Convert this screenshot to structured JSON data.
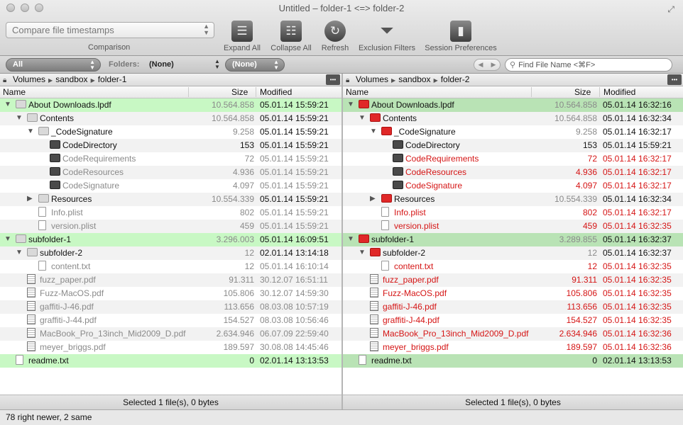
{
  "window": {
    "title": "Untitled – folder-1 <=> folder-2"
  },
  "toolbar": {
    "comparison_value": "Compare file timestamps",
    "comparison_label": "Comparison",
    "expand_all": "Expand All",
    "collapse_all": "Collapse All",
    "refresh": "Refresh",
    "exclusion_filters": "Exclusion Filters",
    "session_preferences": "Session Preferences"
  },
  "filterbar": {
    "view_value": "All",
    "folders_label": "Folders:",
    "folders_value": "(None)",
    "right_filter_value": "(None)",
    "search_placeholder": "Find File Name <⌘F>"
  },
  "columns": {
    "name": "Name",
    "size": "Size",
    "modified": "Modified"
  },
  "left": {
    "path": [
      "Volumes",
      "sandbox",
      "folder-1"
    ],
    "status": "Selected 1 file(s), 0 bytes",
    "rows": [
      {
        "depth": 0,
        "tri": "▼",
        "icon": "folder",
        "name": "About Downloads.lpdf",
        "size": "10.564.858",
        "sz_style": "gray",
        "modified": "05.01.14 15:59:21",
        "md_style": "dark",
        "hl": true
      },
      {
        "depth": 1,
        "tri": "▼",
        "icon": "folder",
        "name": "Contents",
        "size": "10.564.858",
        "sz_style": "gray",
        "modified": "05.01.14 15:59:21",
        "md_style": "dark"
      },
      {
        "depth": 2,
        "tri": "▼",
        "icon": "folder",
        "name": "_CodeSignature",
        "size": "9.258",
        "sz_style": "gray",
        "modified": "05.01.14 15:59:21",
        "md_style": "dark"
      },
      {
        "depth": 3,
        "tri": "",
        "icon": "bundle",
        "name": "CodeDirectory",
        "size": "153",
        "sz_style": "dark",
        "modified": "05.01.14 15:59:21",
        "md_style": "dark",
        "nm_style": "dark"
      },
      {
        "depth": 3,
        "tri": "",
        "icon": "bundle",
        "name": "CodeRequirements",
        "size": "72",
        "sz_style": "gray",
        "modified": "05.01.14 15:59:21",
        "md_style": "gray",
        "nm_style": "gray"
      },
      {
        "depth": 3,
        "tri": "",
        "icon": "bundle",
        "name": "CodeResources",
        "size": "4.936",
        "sz_style": "gray",
        "modified": "05.01.14 15:59:21",
        "md_style": "gray",
        "nm_style": "gray"
      },
      {
        "depth": 3,
        "tri": "",
        "icon": "bundle",
        "name": "CodeSignature",
        "size": "4.097",
        "sz_style": "gray",
        "modified": "05.01.14 15:59:21",
        "md_style": "gray",
        "nm_style": "gray"
      },
      {
        "depth": 2,
        "tri": "▶",
        "icon": "folder",
        "name": "Resources",
        "size": "10.554.339",
        "sz_style": "gray",
        "modified": "05.01.14 15:59:21",
        "md_style": "dark"
      },
      {
        "depth": 2,
        "tri": "",
        "icon": "file",
        "name": "Info.plist",
        "size": "802",
        "sz_style": "gray",
        "modified": "05.01.14 15:59:21",
        "md_style": "gray",
        "nm_style": "gray"
      },
      {
        "depth": 2,
        "tri": "",
        "icon": "file",
        "name": "version.plist",
        "size": "459",
        "sz_style": "gray",
        "modified": "05.01.14 15:59:21",
        "md_style": "gray",
        "nm_style": "gray"
      },
      {
        "depth": 0,
        "tri": "▼",
        "icon": "folder",
        "name": "subfolder-1",
        "size": "3.296.003",
        "sz_style": "gray",
        "modified": "05.01.14 16:09:51",
        "md_style": "dark",
        "hl": true
      },
      {
        "depth": 1,
        "tri": "▼",
        "icon": "folder",
        "name": "subfolder-2",
        "size": "12",
        "sz_style": "gray",
        "modified": "02.01.14 13:14:18",
        "md_style": "dark"
      },
      {
        "depth": 2,
        "tri": "",
        "icon": "file",
        "name": "content.txt",
        "size": "12",
        "sz_style": "gray",
        "modified": "05.01.14 16:10:14",
        "md_style": "gray",
        "nm_style": "gray"
      },
      {
        "depth": 1,
        "tri": "",
        "icon": "fileimg",
        "name": "fuzz_paper.pdf",
        "size": "91.311",
        "sz_style": "gray",
        "modified": "30.12.07 16:51:11",
        "md_style": "gray",
        "nm_style": "gray"
      },
      {
        "depth": 1,
        "tri": "",
        "icon": "fileimg",
        "name": "Fuzz-MacOS.pdf",
        "size": "105.806",
        "sz_style": "gray",
        "modified": "30.12.07 14:59:30",
        "md_style": "gray",
        "nm_style": "gray"
      },
      {
        "depth": 1,
        "tri": "",
        "icon": "fileimg",
        "name": "gaffiti-J-46.pdf",
        "size": "113.656",
        "sz_style": "gray",
        "modified": "08.03.08 10:57:19",
        "md_style": "gray",
        "nm_style": "gray"
      },
      {
        "depth": 1,
        "tri": "",
        "icon": "fileimg",
        "name": "graffiti-J-44.pdf",
        "size": "154.527",
        "sz_style": "gray",
        "modified": "08.03.08 10:56:46",
        "md_style": "gray",
        "nm_style": "gray"
      },
      {
        "depth": 1,
        "tri": "",
        "icon": "fileimg",
        "name": "MacBook_Pro_13inch_Mid2009_D.pdf",
        "size": "2.634.946",
        "sz_style": "gray",
        "modified": "06.07.09 22:59:40",
        "md_style": "gray",
        "nm_style": "gray"
      },
      {
        "depth": 1,
        "tri": "",
        "icon": "fileimg",
        "name": "meyer_briggs.pdf",
        "size": "189.597",
        "sz_style": "gray",
        "modified": "30.08.08 14:45:46",
        "md_style": "gray",
        "nm_style": "gray"
      },
      {
        "depth": 0,
        "tri": "",
        "icon": "file",
        "name": "readme.txt",
        "size": "0",
        "sz_style": "dark",
        "modified": "02.01.14 13:13:53",
        "md_style": "dark",
        "hl": true
      }
    ]
  },
  "right": {
    "path": [
      "Volumes",
      "sandbox",
      "folder-2"
    ],
    "status": "Selected 1 file(s), 0 bytes",
    "rows": [
      {
        "depth": 0,
        "tri": "▼",
        "icon": "folder",
        "name": "About Downloads.lpdf",
        "size": "10.564.858",
        "sz_style": "gray",
        "modified": "05.01.14 16:32:16",
        "md_style": "dark",
        "hl": true
      },
      {
        "depth": 1,
        "tri": "▼",
        "icon": "folder",
        "name": "Contents",
        "size": "10.564.858",
        "sz_style": "gray",
        "modified": "05.01.14 16:32:34",
        "md_style": "dark"
      },
      {
        "depth": 2,
        "tri": "▼",
        "icon": "folder",
        "name": "_CodeSignature",
        "size": "9.258",
        "sz_style": "gray",
        "modified": "05.01.14 16:32:17",
        "md_style": "dark"
      },
      {
        "depth": 3,
        "tri": "",
        "icon": "bundle",
        "name": "CodeDirectory",
        "size": "153",
        "sz_style": "dark",
        "modified": "05.01.14 15:59:21",
        "md_style": "dark",
        "nm_style": "dark"
      },
      {
        "depth": 3,
        "tri": "",
        "icon": "bundle",
        "name": "CodeRequirements",
        "size": "72",
        "sz_style": "red",
        "modified": "05.01.14 16:32:17",
        "md_style": "red",
        "nm_style": "red"
      },
      {
        "depth": 3,
        "tri": "",
        "icon": "bundle",
        "name": "CodeResources",
        "size": "4.936",
        "sz_style": "red",
        "modified": "05.01.14 16:32:17",
        "md_style": "red",
        "nm_style": "red"
      },
      {
        "depth": 3,
        "tri": "",
        "icon": "bundle",
        "name": "CodeSignature",
        "size": "4.097",
        "sz_style": "red",
        "modified": "05.01.14 16:32:17",
        "md_style": "red",
        "nm_style": "red"
      },
      {
        "depth": 2,
        "tri": "▶",
        "icon": "folder",
        "name": "Resources",
        "size": "10.554.339",
        "sz_style": "gray",
        "modified": "05.01.14 16:32:34",
        "md_style": "dark"
      },
      {
        "depth": 2,
        "tri": "",
        "icon": "file",
        "name": "Info.plist",
        "size": "802",
        "sz_style": "red",
        "modified": "05.01.14 16:32:17",
        "md_style": "red",
        "nm_style": "red"
      },
      {
        "depth": 2,
        "tri": "",
        "icon": "file",
        "name": "version.plist",
        "size": "459",
        "sz_style": "red",
        "modified": "05.01.14 16:32:35",
        "md_style": "red",
        "nm_style": "red"
      },
      {
        "depth": 0,
        "tri": "▼",
        "icon": "folder",
        "name": "subfolder-1",
        "size": "3.289.855",
        "sz_style": "gray",
        "modified": "05.01.14 16:32:37",
        "md_style": "dark",
        "hl": true
      },
      {
        "depth": 1,
        "tri": "▼",
        "icon": "folder",
        "name": "subfolder-2",
        "size": "12",
        "sz_style": "gray",
        "modified": "05.01.14 16:32:37",
        "md_style": "dark"
      },
      {
        "depth": 2,
        "tri": "",
        "icon": "file",
        "name": "content.txt",
        "size": "12",
        "sz_style": "red",
        "modified": "05.01.14 16:32:35",
        "md_style": "red",
        "nm_style": "red"
      },
      {
        "depth": 1,
        "tri": "",
        "icon": "fileimg",
        "name": "fuzz_paper.pdf",
        "size": "91.311",
        "sz_style": "red",
        "modified": "05.01.14 16:32:35",
        "md_style": "red",
        "nm_style": "red"
      },
      {
        "depth": 1,
        "tri": "",
        "icon": "fileimg",
        "name": "Fuzz-MacOS.pdf",
        "size": "105.806",
        "sz_style": "red",
        "modified": "05.01.14 16:32:35",
        "md_style": "red",
        "nm_style": "red"
      },
      {
        "depth": 1,
        "tri": "",
        "icon": "fileimg",
        "name": "gaffiti-J-46.pdf",
        "size": "113.656",
        "sz_style": "red",
        "modified": "05.01.14 16:32:35",
        "md_style": "red",
        "nm_style": "red"
      },
      {
        "depth": 1,
        "tri": "",
        "icon": "fileimg",
        "name": "graffiti-J-44.pdf",
        "size": "154.527",
        "sz_style": "red",
        "modified": "05.01.14 16:32:35",
        "md_style": "red",
        "nm_style": "red"
      },
      {
        "depth": 1,
        "tri": "",
        "icon": "fileimg",
        "name": "MacBook_Pro_13inch_Mid2009_D.pdf",
        "size": "2.634.946",
        "sz_style": "red",
        "modified": "05.01.14 16:32:36",
        "md_style": "red",
        "nm_style": "red"
      },
      {
        "depth": 1,
        "tri": "",
        "icon": "fileimg",
        "name": "meyer_briggs.pdf",
        "size": "189.597",
        "sz_style": "red",
        "modified": "05.01.14 16:32:36",
        "md_style": "red",
        "nm_style": "red"
      },
      {
        "depth": 0,
        "tri": "",
        "icon": "file",
        "name": "readme.txt",
        "size": "0",
        "sz_style": "dark",
        "modified": "02.01.14 13:13:53",
        "md_style": "dark",
        "hl": true
      }
    ]
  },
  "footer": {
    "summary": "78 right newer, 2 same"
  }
}
